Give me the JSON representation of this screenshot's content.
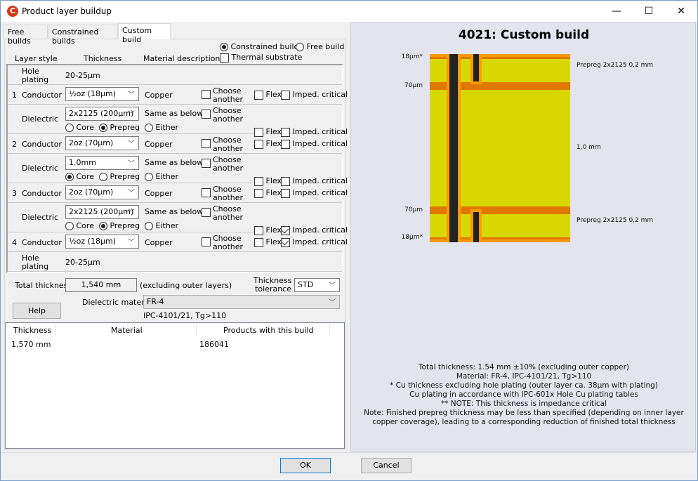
{
  "window": {
    "title": "Product layer buildup",
    "app_icon": "C",
    "minimize": "—",
    "maximize": "☐",
    "close": "✕"
  },
  "tabs": [
    {
      "label": "Free builds"
    },
    {
      "label": "Constrained builds"
    },
    {
      "label": "Custom build",
      "active": true
    }
  ],
  "header": {
    "layer_style": "Layer style",
    "thickness": "Thickness",
    "material_description": "Material description",
    "constrained_build": "Constrained build",
    "free_build": "Free build",
    "thermal_substrate": "Thermal substrate",
    "build_mode": "constrained",
    "thermal_checked": false
  },
  "labels": {
    "choose": "Choose",
    "another": "another",
    "flex": "Flex",
    "imped": "Imped. critical",
    "core": "Core",
    "prepreg": "Prepreg",
    "either": "Either"
  },
  "rows": [
    {
      "type": "hole",
      "label1": "Hole",
      "label2": "plating",
      "value": "20-25µm"
    },
    {
      "type": "conductor",
      "num": "1",
      "label": "Conductor",
      "thickness": "½oz (18µm)",
      "material": "Copper",
      "choose": false,
      "flex": false,
      "imped": false
    },
    {
      "type": "dielectric",
      "label": "Dielectric",
      "thickness": "2x2125 (200µm)",
      "material": "Same as below",
      "choose": false,
      "kind": "prepreg",
      "flex": false,
      "imped": false
    },
    {
      "type": "conductor",
      "num": "2",
      "label": "Conductor",
      "thickness": "2oz (70µm)",
      "material": "Copper",
      "choose": false,
      "flex": false,
      "imped": false
    },
    {
      "type": "dielectric",
      "label": "Dielectric",
      "thickness": "1.0mm",
      "material": "Same as below",
      "choose": false,
      "kind": "core",
      "flex": false,
      "imped": false
    },
    {
      "type": "conductor",
      "num": "3",
      "label": "Conductor",
      "thickness": "2oz (70µm)",
      "material": "Copper",
      "choose": false,
      "flex": false,
      "imped": false
    },
    {
      "type": "dielectric",
      "label": "Dielectric",
      "thickness": "2x2125 (200µm)",
      "material": "Same as below",
      "choose": false,
      "kind": "prepreg",
      "flex": false,
      "imped": true
    },
    {
      "type": "conductor",
      "num": "4",
      "label": "Conductor",
      "thickness": "½oz (18µm)",
      "material": "Copper",
      "choose": false,
      "flex": false,
      "imped": true
    },
    {
      "type": "hole",
      "label1": "Hole",
      "label2": "plating",
      "value": "20-25µm"
    }
  ],
  "summary": {
    "total_thickness_label": "Total thickness",
    "total_thickness": "1,540 mm",
    "excluding": "(excluding outer layers)",
    "tolerance_label1": "Thickness",
    "tolerance_label2": "tolerance",
    "tolerance": "STD",
    "help": "Help",
    "dielectric_label": "Dielectric material",
    "dielectric": "FR-4",
    "dielectric_spec": "IPC-4101/21, Tg>110"
  },
  "table": {
    "columns": [
      "Thickness",
      "Material",
      "Products with this build"
    ],
    "rows": [
      [
        "1,570 mm",
        "",
        "186041"
      ]
    ]
  },
  "preview": {
    "title": "4021: Custom build",
    "left_labels": [
      "18µm*",
      "70µm",
      "70µm",
      "18µm*"
    ],
    "right_labels": [
      "Prepreg 2x2125 0,2 mm",
      "1,0 mm",
      "Prepreg 2x2125 0,2 mm"
    ],
    "colors": {
      "copper_outer": "#FF9A00",
      "copper_inner": "#DF7700",
      "dielectric": "#D8D800",
      "via": "#222222"
    },
    "notes": [
      "Total thickness: 1.54 mm ±10% (excluding outer copper)",
      "Material: FR-4, IPC-4101/21, Tg>110",
      "* Cu thickness excluding hole plating (outer layer ca. 38µm with plating)",
      "Cu plating in accordance with IPC-601x Hole Cu plating tables",
      "** NOTE: This thickness is impedance critical",
      "Note: Finished prepreg thickness may be less than specified (depending on inner layer",
      "copper coverage), leading to a corresponding reduction of finished total thickness"
    ]
  },
  "buttons": {
    "ok": "OK",
    "cancel": "Cancel"
  }
}
